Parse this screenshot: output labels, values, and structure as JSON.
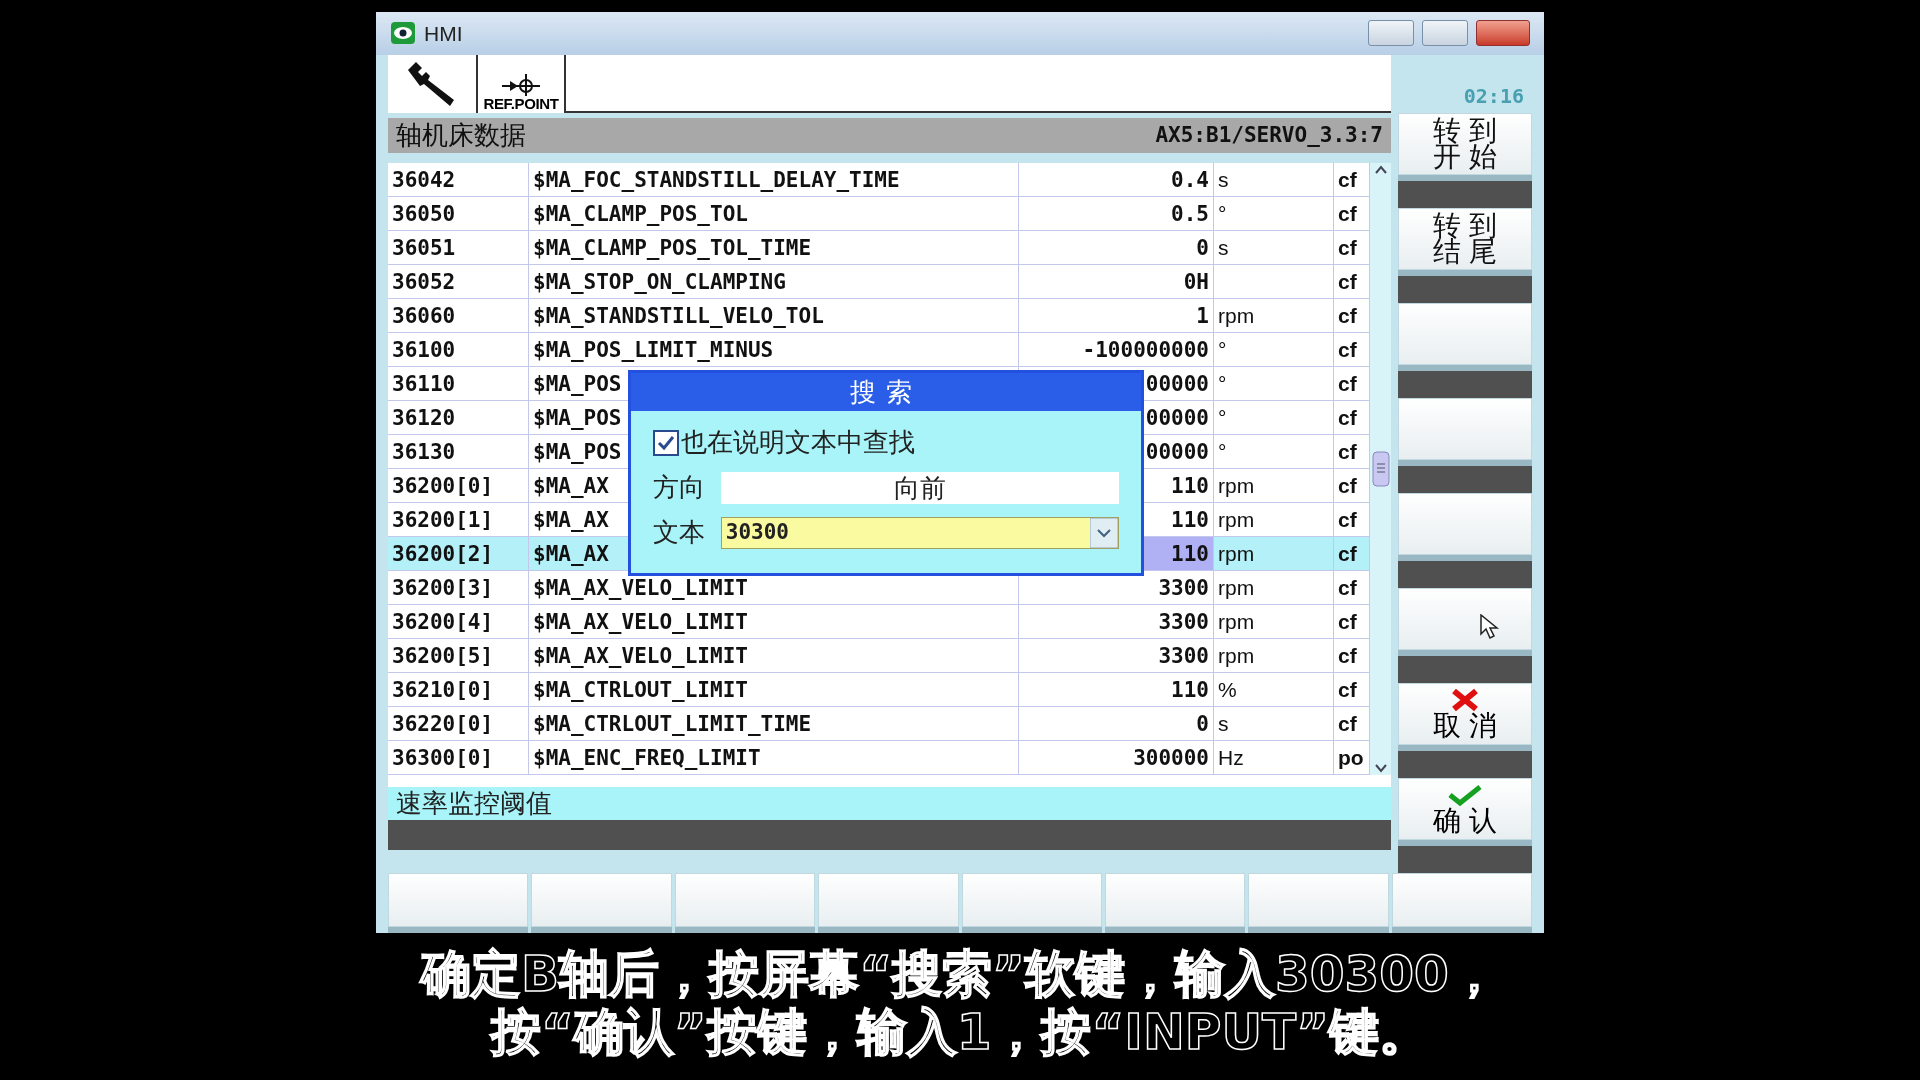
{
  "window": {
    "title": "HMI"
  },
  "toolbar": [
    {
      "kind": "wrench"
    },
    {
      "kind": "refpoint",
      "label": "REF.POINT"
    }
  ],
  "clock": "02:16",
  "header": {
    "title": "轴机床数据",
    "path": "AX5:B1/SERVO_3.3:7"
  },
  "table": {
    "rows": [
      {
        "id": "36042",
        "name": "$MA_FOC_STANDSTILL_DELAY_TIME",
        "value": "0.4",
        "unit": "s",
        "type": "cf",
        "selected": false
      },
      {
        "id": "36050",
        "name": "$MA_CLAMP_POS_TOL",
        "value": "0.5",
        "unit": "°",
        "type": "cf",
        "selected": false
      },
      {
        "id": "36051",
        "name": "$MA_CLAMP_POS_TOL_TIME",
        "value": "0",
        "unit": "s",
        "type": "cf",
        "selected": false
      },
      {
        "id": "36052",
        "name": "$MA_STOP_ON_CLAMPING",
        "value": "0H",
        "unit": "",
        "type": "cf",
        "selected": false
      },
      {
        "id": "36060",
        "name": "$MA_STANDSTILL_VELO_TOL",
        "value": "1",
        "unit": "rpm",
        "type": "cf",
        "selected": false
      },
      {
        "id": "36100",
        "name": "$MA_POS_LIMIT_MINUS",
        "value": "-100000000",
        "unit": "°",
        "type": "cf",
        "selected": false
      },
      {
        "id": "36110",
        "name": "$MA_POS",
        "value": "00000",
        "unit": "°",
        "type": "cf",
        "selected": false
      },
      {
        "id": "36120",
        "name": "$MA_POS",
        "value": "00000",
        "unit": "°",
        "type": "cf",
        "selected": false
      },
      {
        "id": "36130",
        "name": "$MA_POS",
        "value": "00000",
        "unit": "°",
        "type": "cf",
        "selected": false
      },
      {
        "id": "36200[0]",
        "name": "$MA_AX",
        "value": "110",
        "unit": "rpm",
        "type": "cf",
        "selected": false
      },
      {
        "id": "36200[1]",
        "name": "$MA_AX",
        "value": "110",
        "unit": "rpm",
        "type": "cf",
        "selected": false
      },
      {
        "id": "36200[2]",
        "name": "$MA_AX",
        "value": "110",
        "unit": "rpm",
        "type": "cf",
        "selected": true
      },
      {
        "id": "36200[3]",
        "name": "$MA_AX_VELO_LIMIT",
        "value": "3300",
        "unit": "rpm",
        "type": "cf",
        "selected": false
      },
      {
        "id": "36200[4]",
        "name": "$MA_AX_VELO_LIMIT",
        "value": "3300",
        "unit": "rpm",
        "type": "cf",
        "selected": false
      },
      {
        "id": "36200[5]",
        "name": "$MA_AX_VELO_LIMIT",
        "value": "3300",
        "unit": "rpm",
        "type": "cf",
        "selected": false
      },
      {
        "id": "36210[0]",
        "name": "$MA_CTRLOUT_LIMIT",
        "value": "110",
        "unit": "%",
        "type": "cf",
        "selected": false
      },
      {
        "id": "36220[0]",
        "name": "$MA_CTRLOUT_LIMIT_TIME",
        "value": "0",
        "unit": "s",
        "type": "cf",
        "selected": false
      },
      {
        "id": "36300[0]",
        "name": "$MA_ENC_FREQ_LIMIT",
        "value": "300000",
        "unit": "Hz",
        "type": "po",
        "selected": false
      }
    ]
  },
  "description": "速率监控阈值",
  "dialog": {
    "title": "搜索",
    "checkbox": {
      "label": "也在说明文本中查找",
      "checked": true
    },
    "direction": {
      "label": "方向",
      "value": "向前"
    },
    "text": {
      "label": "文本",
      "value": "30300"
    }
  },
  "side_keys": [
    {
      "kind": "text",
      "lines": [
        "转 到",
        "开 始"
      ]
    },
    {
      "kind": "text",
      "lines": [
        "转 到",
        "结 尾"
      ]
    },
    {
      "kind": "blank"
    },
    {
      "kind": "blank"
    },
    {
      "kind": "blank"
    },
    {
      "kind": "blank"
    },
    {
      "kind": "cancel",
      "label": "取 消"
    },
    {
      "kind": "confirm",
      "label": "确 认"
    }
  ],
  "subtitle": [
    "确定B轴后，按屏幕“搜索”软键，输入30300，",
    "按“确认”按键，输入1，按“INPUT”键。"
  ]
}
